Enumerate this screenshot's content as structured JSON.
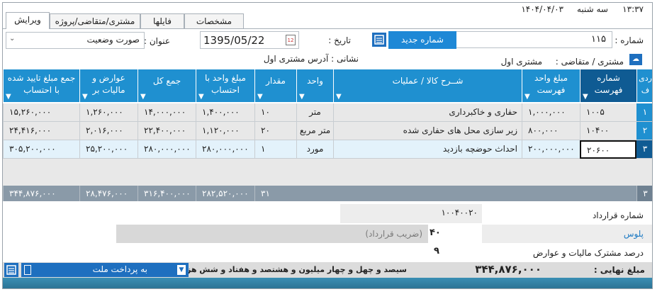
{
  "titlebar": {
    "time": "۱۳:۳۷",
    "day": "سه شنبه",
    "date": "۱۴۰۴/۰۴/۰۳"
  },
  "tabs": [
    {
      "label": "ویرایش",
      "active": true
    },
    {
      "label": "مشتری/متقاضی/پروژه",
      "active": false
    },
    {
      "label": "فایلها",
      "active": false
    },
    {
      "label": "مشخصات",
      "active": false
    }
  ],
  "form": {
    "number_label": "شماره :",
    "number_value": "۱۱۵",
    "new_number_button": "شماره جدید",
    "date_label": "تاریخ :",
    "date_value": "1395/05/22",
    "title_label": "عنوان :",
    "title_value": "صورت وضعیت",
    "customer_label": "مشتری / متقاضی :",
    "customer_value": "مشتری اول",
    "address_label": "نشانی : آدرس مشتری اول"
  },
  "grid": {
    "columns": [
      "ردی ف",
      "شماره فهرست",
      "مبلغ واحد فهرست",
      "شــرح کالا / عملیات",
      "واحد",
      "مقدار",
      "مبلغ واحد با احتساب",
      "جمع کل",
      "عوارض و مالیات بر",
      "جمع مبلغ تایید شده با احتساب"
    ],
    "rows": [
      {
        "row_no": "۱",
        "item_no": "۱۰۰۵",
        "unit_price": "۱,۰۰۰,۰۰۰",
        "desc": "حفاری و خاکبرداری",
        "unit": "متر",
        "qty": "۱۰",
        "adj_price": "۱,۴۰۰,۰۰۰",
        "total": "۱۴,۰۰۰,۰۰۰",
        "tax": "۱,۲۶۰,۰۰۰",
        "approved": "۱۵,۲۶۰,۰۰۰"
      },
      {
        "row_no": "۲",
        "item_no": "۱۰۴۰۰",
        "unit_price": "۸۰۰,۰۰۰",
        "desc": "زیر سازی محل های حفاری شده",
        "unit": "متر مربع",
        "qty": "۲۰",
        "adj_price": "۱,۱۲۰,۰۰۰",
        "total": "۲۲,۴۰۰,۰۰۰",
        "tax": "۲,۰۱۶,۰۰۰",
        "approved": "۲۴,۴۱۶,۰۰۰"
      },
      {
        "row_no": "۳",
        "item_no": "۲۰۶۰۰",
        "unit_price": "۲۰۰,۰۰۰,۰۰۰",
        "desc": "احداث حوضچه بازدید",
        "unit": "مورد",
        "qty": "۱",
        "adj_price": "۲۸۰,۰۰۰,۰۰۰",
        "total": "۲۸۰,۰۰۰,۰۰۰",
        "tax": "۲۵,۲۰۰,۰۰۰",
        "approved": "۳۰۵,۲۰۰,۰۰۰"
      }
    ],
    "totals": {
      "count": "۳",
      "qty": "۳۱",
      "adj_price": "۲۸۲,۵۲۰,۰۰۰",
      "total": "۳۱۶,۴۰۰,۰۰۰",
      "tax": "۲۸,۴۷۶,۰۰۰",
      "approved": "۳۴۴,۸۷۶,۰۰۰"
    }
  },
  "summary": {
    "contract_label": "شماره قرارداد",
    "contract_value": "۱۰۰۴۰۰۲۰",
    "plus_label": "پلوس",
    "plus_value": "۴۰",
    "coef_label": "(ضریب قرارداد)",
    "tax_label": "درصد مشترک مالیات و عوارض",
    "tax_value": "۹"
  },
  "footer": {
    "final_label": "مبلغ نهایی :",
    "final_value": "۳۴۴,۸۷۶,۰۰۰",
    "final_words": "سیصد و چهل و چهار میلیون و هشتصد و هفتاد و شش هزار  ریال",
    "payment_value": "به پرداخت ملت"
  },
  "colors": {
    "header": "#1f90d0",
    "header_dark": "#0f5b93",
    "totals": "#8a9aa8",
    "selected": "#e3f2fb"
  }
}
